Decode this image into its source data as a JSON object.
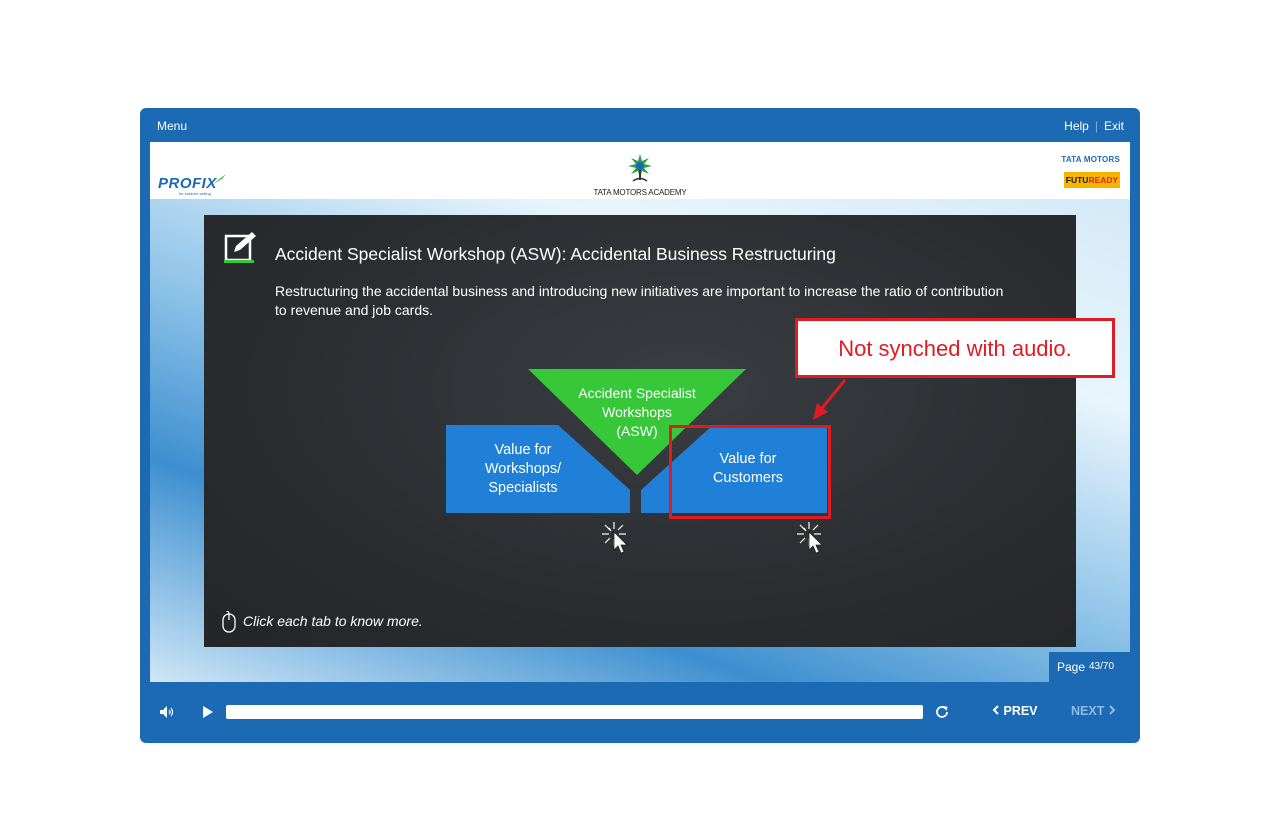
{
  "topbar": {
    "menu": "Menu",
    "help": "Help",
    "separator": "|",
    "exit": "Exit"
  },
  "header": {
    "profix_logo": "PROFIX",
    "profix_tagline": "for smarter selling",
    "academy_logo": "TATA MOTORS ACADEMY",
    "tata_motors_logo": "TATA MOTORS",
    "futuready_logo_a": "FUTU",
    "futuready_logo_b": "READY"
  },
  "slide": {
    "title": "Accident Specialist Workshop (ASW): Accidental Business Restructuring",
    "description": "Restructuring the accidental business and introducing new initiatives are important to increase the ratio of contribution to revenue and job cards.",
    "center_tab_line1": "Accident Specialist",
    "center_tab_line2": "Workshops",
    "center_tab_line3": "(ASW)",
    "left_tab_line1": "Value for",
    "left_tab_line2": "Workshops/",
    "left_tab_line3": "Specialists",
    "right_tab_line1": "Value for",
    "right_tab_line2": "Customers",
    "hint": "Click each tab to know more.",
    "triangle_color": "#37c83a",
    "tab_color": "#2080d8"
  },
  "page": {
    "label": "Page",
    "current": "43/70"
  },
  "controls": {
    "prev": "PREV",
    "next": "NEXT",
    "progress": 0.0
  },
  "annotation": {
    "text": "Not synched with audio.",
    "color": "#e01b24"
  },
  "icons": {
    "edit": "edit-note-icon",
    "mouse": "mouse-icon",
    "volume": "volume-icon",
    "play": "play-icon",
    "replay": "replay-icon",
    "click_cursor": "click-cursor-icon"
  },
  "colors": {
    "player": "#1c6ab4",
    "slide_bg": "#2b2e31",
    "futuready": "#f7b500"
  }
}
